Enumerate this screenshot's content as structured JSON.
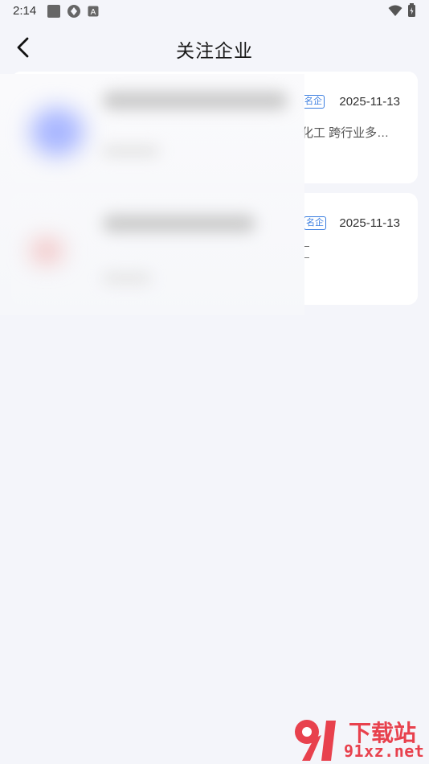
{
  "status_bar": {
    "time": "2:14"
  },
  "header": {
    "title": "关注企业"
  },
  "cards": [
    {
      "badge": "名企",
      "date": "2025-11-13",
      "desc": "化工 跨行业多…"
    },
    {
      "badge": "名企",
      "date": "2025-11-13",
      "desc": ""
    }
  ],
  "watermark": {
    "brand_cn": "下载站",
    "brand_url": "91xz.net",
    "logo_mark": "91"
  },
  "colors": {
    "background": "#f4f5fa",
    "accent_blue": "#3a7de0",
    "watermark_red": "#e8414d"
  }
}
